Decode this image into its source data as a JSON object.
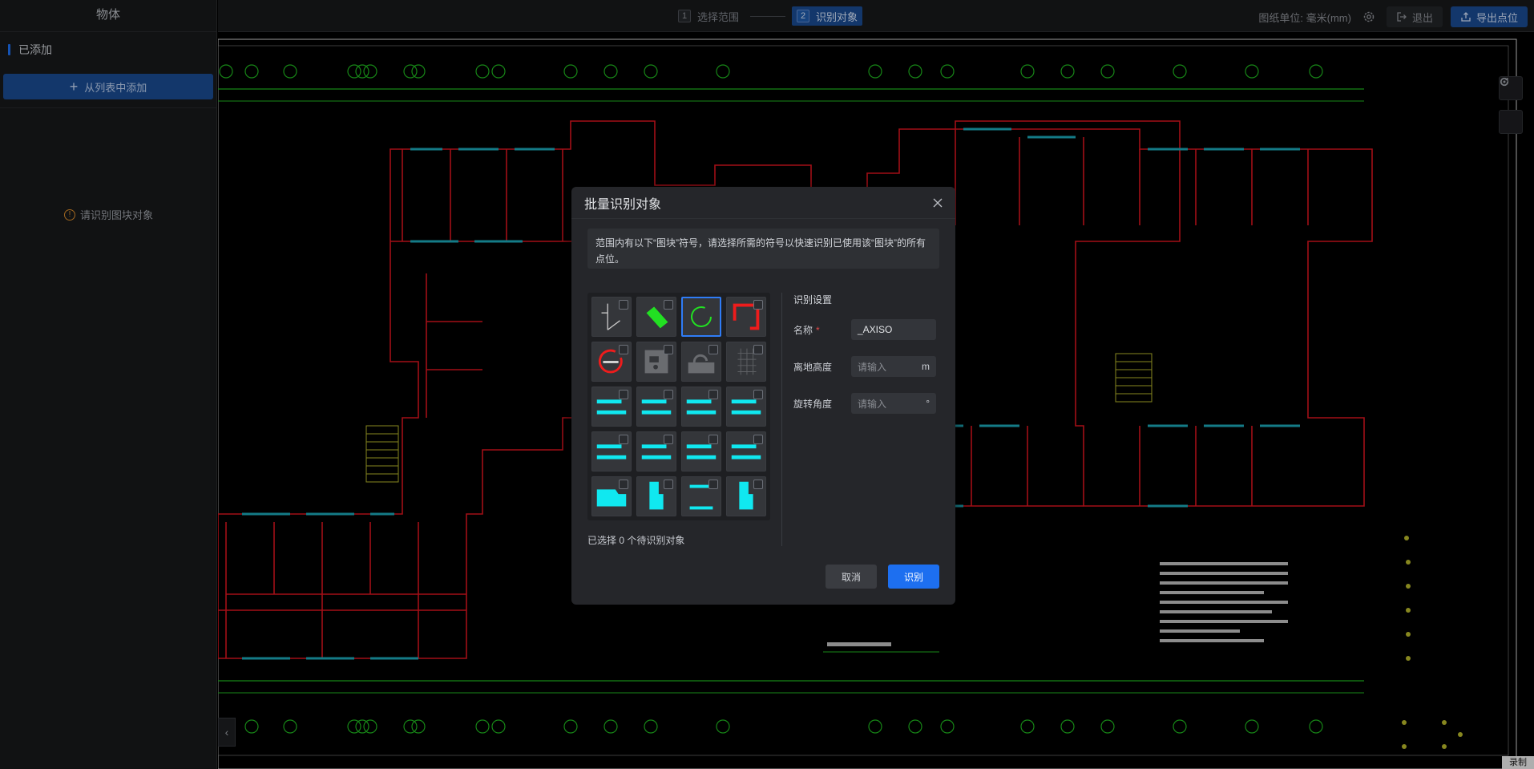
{
  "sidebar": {
    "title": "物体",
    "section_label": "已添加",
    "add_button_label": "从列表中添加",
    "empty_hint": "请识别图块对象",
    "accent_color": "#1d6ff0"
  },
  "topbar": {
    "steps": [
      {
        "num": "1",
        "label": "选择范围",
        "active": false
      },
      {
        "num": "2",
        "label": "识别对象",
        "active": true
      }
    ],
    "unit_label": "图纸单位: 毫米(mm)",
    "exit_label": "退出",
    "export_label": "导出点位"
  },
  "canvas": {
    "record_label": "录制"
  },
  "modal": {
    "title": "批量识别对象",
    "notice": "范围内有以下“图块”符号，请选择所需的符号以快速识别已使用该“图块”的所有点位。",
    "symbols": [
      {
        "icon": "door-line-symbol-icon",
        "selected": false
      },
      {
        "icon": "green-slash-symbol-icon",
        "selected": false
      },
      {
        "icon": "green-arc-symbol-icon",
        "selected": true
      },
      {
        "icon": "red-bracket-symbol-icon",
        "selected": false
      },
      {
        "icon": "red-circle-symbol-icon",
        "selected": false
      },
      {
        "icon": "gray-equipment-symbol-icon",
        "selected": false
      },
      {
        "icon": "gray-sink-symbol-icon",
        "selected": false
      },
      {
        "icon": "gray-grid-symbol-icon",
        "selected": false
      },
      {
        "icon": "cyan-window-symbol-icon",
        "selected": false
      },
      {
        "icon": "cyan-window-symbol-icon",
        "selected": false
      },
      {
        "icon": "cyan-window-symbol-icon",
        "selected": false
      },
      {
        "icon": "cyan-window-symbol-icon",
        "selected": false
      },
      {
        "icon": "cyan-window-symbol-icon",
        "selected": false
      },
      {
        "icon": "cyan-window-symbol-icon",
        "selected": false
      },
      {
        "icon": "cyan-window-symbol-icon",
        "selected": false
      },
      {
        "icon": "cyan-window-symbol-icon",
        "selected": false
      },
      {
        "icon": "cyan-block-symbol-icon",
        "selected": false
      },
      {
        "icon": "cyan-column-symbol-icon",
        "selected": false
      },
      {
        "icon": "cyan-step-symbol-icon",
        "selected": false
      },
      {
        "icon": "cyan-column-symbol-icon",
        "selected": false
      }
    ],
    "selected_count_text": "已选择 0 个待识别对象",
    "settings": {
      "title": "识别设置",
      "name_label": "名称",
      "name_value": "_AXISO",
      "height_label": "离地高度",
      "height_placeholder": "请输入",
      "height_unit": "m",
      "angle_label": "旋转角度",
      "angle_placeholder": "请输入",
      "angle_unit": "°"
    },
    "cancel_label": "取消",
    "ok_label": "识别"
  }
}
